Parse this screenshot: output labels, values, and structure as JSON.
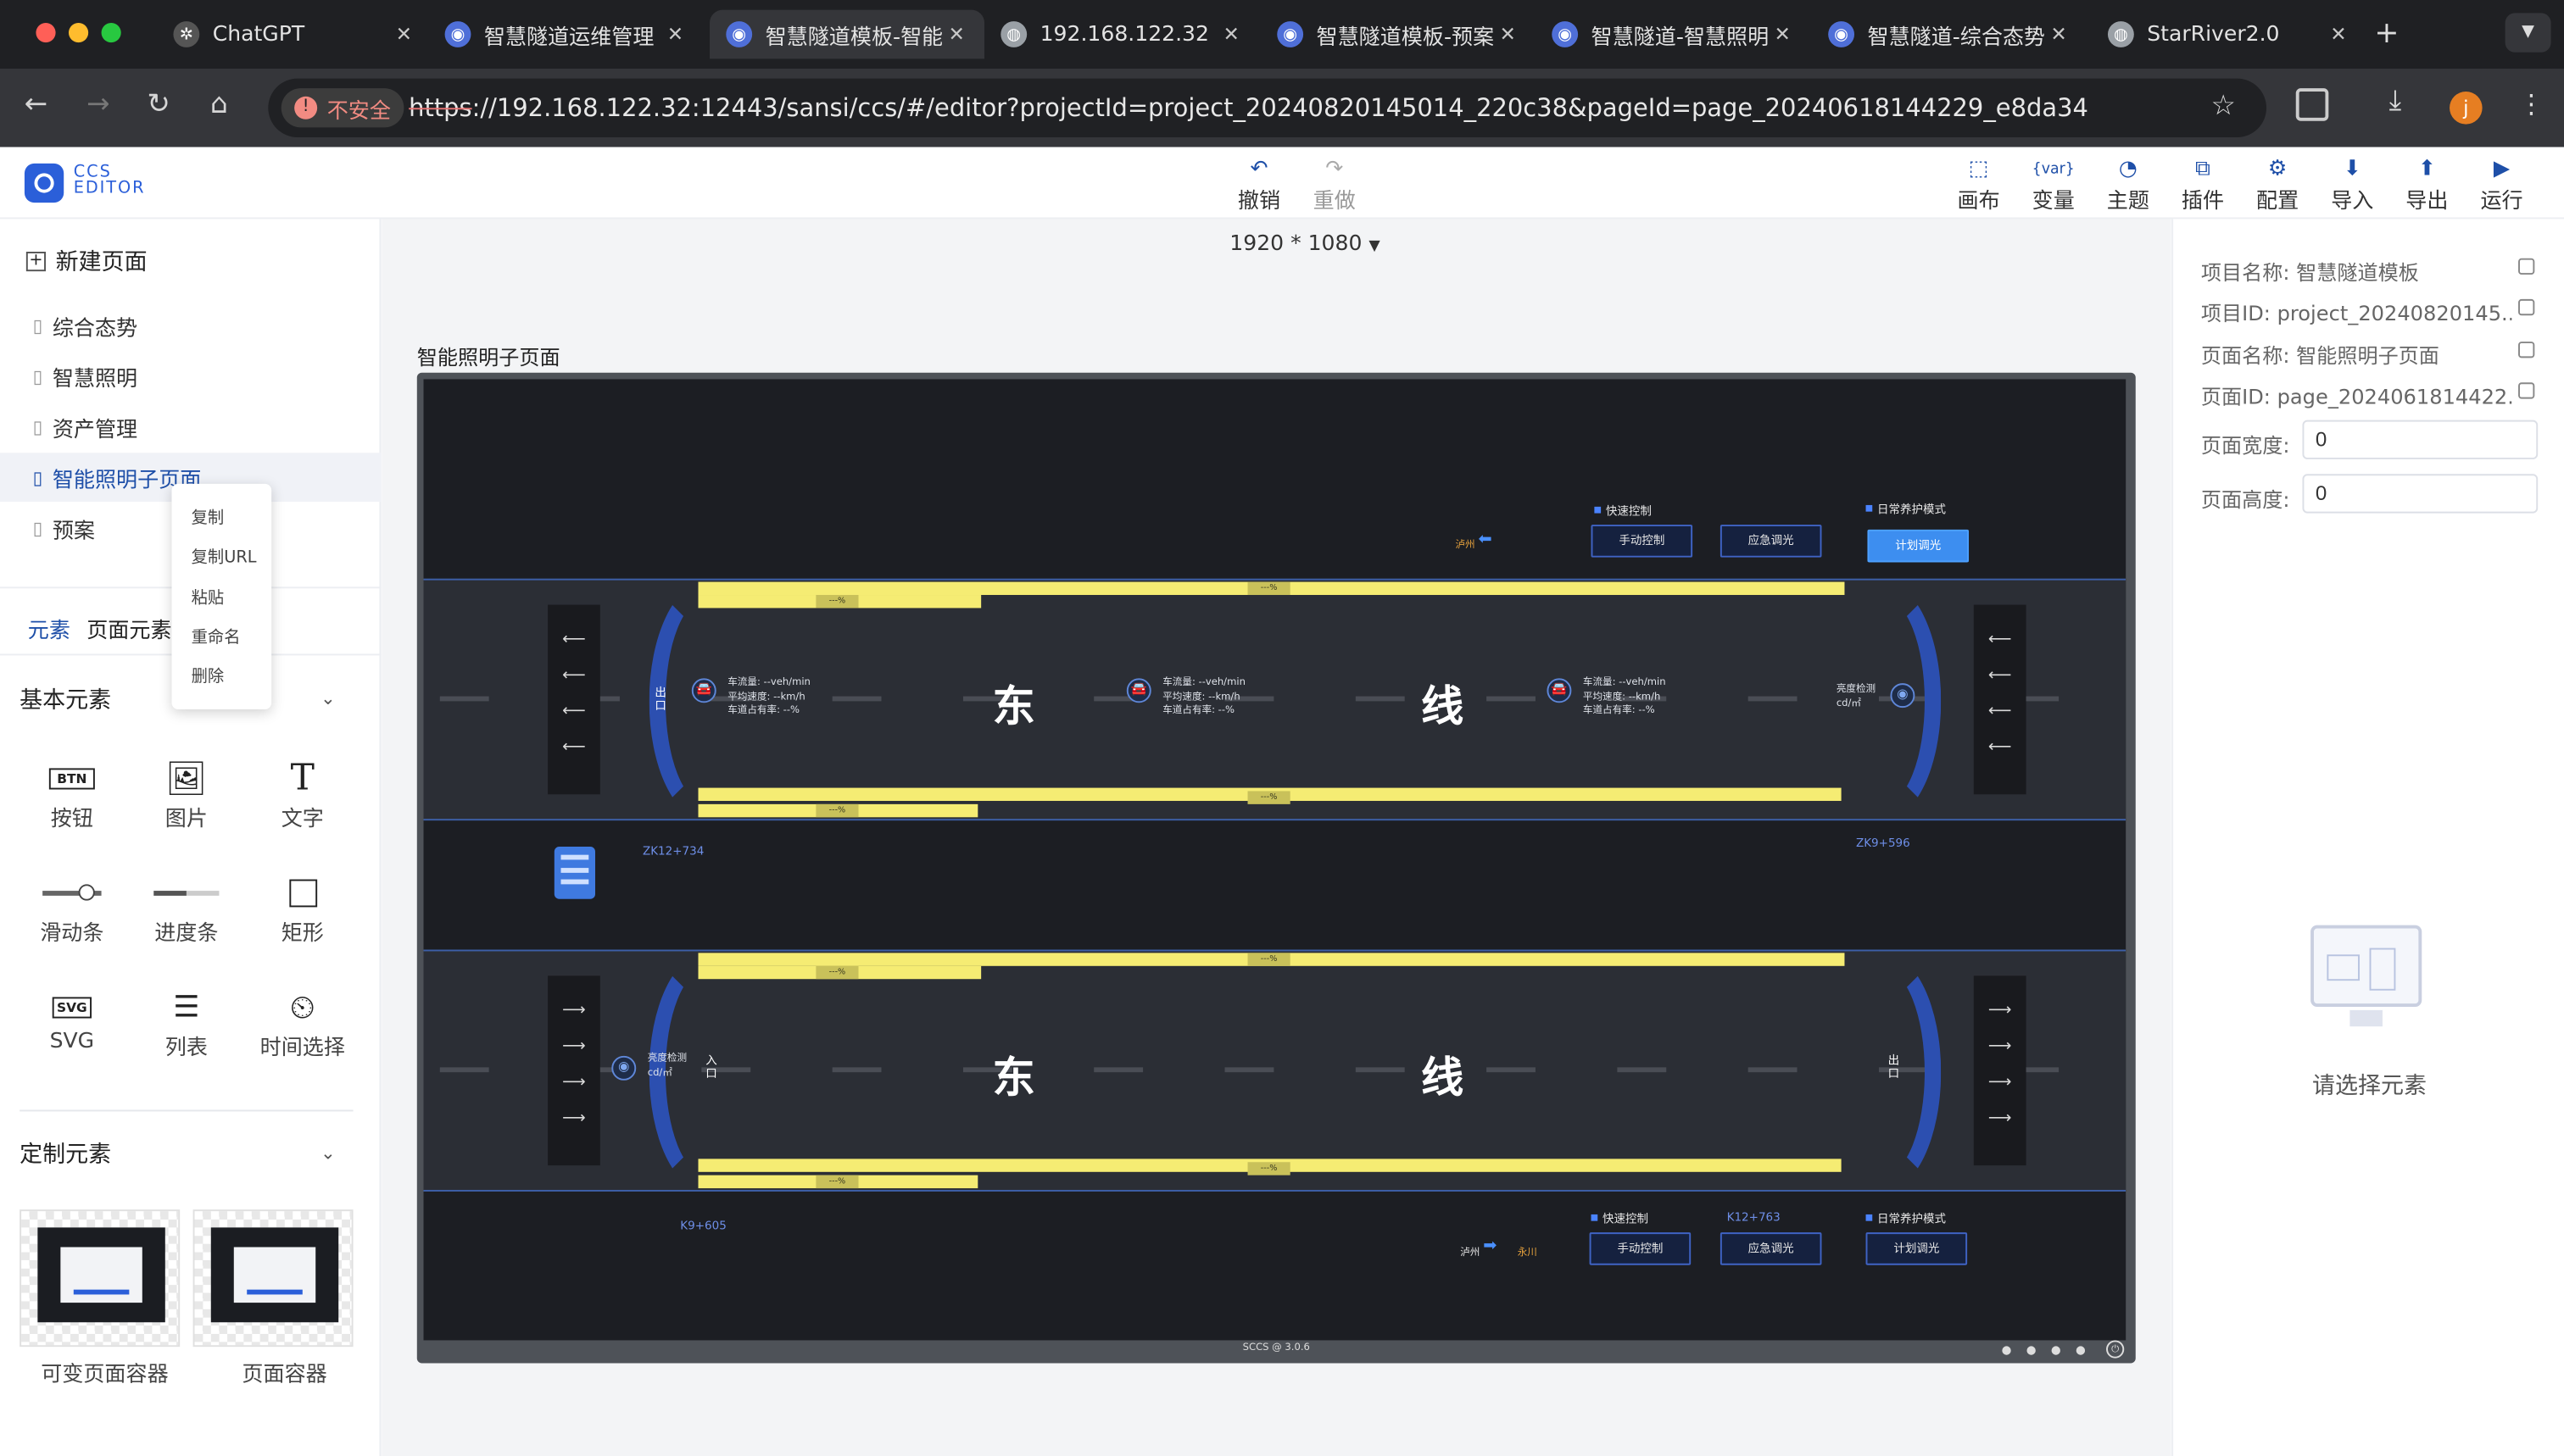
{
  "browser": {
    "tabs": [
      {
        "title": "ChatGPT",
        "icon": "chatgpt-icon",
        "active": false
      },
      {
        "title": "智慧隧道运维管理",
        "icon": "app-icon",
        "active": false
      },
      {
        "title": "智慧隧道模板-智能",
        "icon": "app-icon",
        "active": true
      },
      {
        "title": "192.168.122.32",
        "icon": "globe-icon",
        "active": false
      },
      {
        "title": "智慧隧道模板-预案",
        "icon": "app-icon",
        "active": false
      },
      {
        "title": "智慧隧道-智慧照明",
        "icon": "app-icon",
        "active": false
      },
      {
        "title": "智慧隧道-综合态势",
        "icon": "app-icon",
        "active": false
      },
      {
        "title": "StarRiver2.0",
        "icon": "globe-icon",
        "active": false
      }
    ],
    "security_label": "不安全",
    "url_scheme": "https",
    "url_rest": "://192.168.122.32:12443/sansi/ccs/#/editor?projectId=project_20240820145014_220c38&pageId=page_20240618144229_e8da34",
    "profile_initial": "j"
  },
  "logo": {
    "line1": "CCS",
    "line2": "EDITOR"
  },
  "toolbar": {
    "undo": "撤销",
    "redo": "重做",
    "right": [
      "画布",
      "变量",
      "主题",
      "插件",
      "配置",
      "导入",
      "导出",
      "运行"
    ]
  },
  "left": {
    "new_page": "新建页面",
    "pages": [
      "综合态势",
      "智慧照明",
      "资产管理",
      "智能照明子页面",
      "预案"
    ],
    "context_menu": [
      "复制",
      "复制URL",
      "粘贴",
      "重命名",
      "删除"
    ],
    "tabs": [
      "元素",
      "页面元素"
    ],
    "basic_title": "基本元素",
    "basic_elements": [
      "按钮",
      "图片",
      "文字",
      "滑动条",
      "进度条",
      "矩形",
      "SVG",
      "列表",
      "时间选择"
    ],
    "custom_title": "定制元素",
    "custom_elements": [
      "可变页面容器",
      "页面容器"
    ],
    "btn_icon_text": "BTN",
    "svg_icon_text": "SVG"
  },
  "center": {
    "resolution": "1920 * 1080",
    "page_title": "智能照明子页面"
  },
  "right": {
    "project_name_label": "项目名称:",
    "project_name": "智慧隧道模板",
    "project_id_label": "项目ID:",
    "project_id": "project_20240820145...",
    "page_name_label": "页面名称:",
    "page_name": "智能照明子页面",
    "page_id_label": "页面ID:",
    "page_id": "page_2024061814422...",
    "width_label": "页面宽度:",
    "width_value": "0",
    "height_label": "页面高度:",
    "height_value": "0",
    "empty_hint": "请选择元素"
  },
  "canvas": {
    "quick_control": "快速控制",
    "daily_mode": "日常养护模式",
    "manual": "手动控制",
    "emergency": "应急调光",
    "plan": "计划调光",
    "luzhou": "泸州",
    "yongchuan": "永川",
    "big1": "东",
    "big2": "线",
    "info_lines": [
      "车流量: --veh/min",
      "平均速度: --km/h",
      "车道占有率: --%"
    ],
    "pct": "---%",
    "exit_label": "出口",
    "entry_label": "入口",
    "brightness_label": "亮度检测",
    "brightness_unit": "cd/㎡",
    "stake1": "ZK12+734",
    "stake2": "ZK9+596",
    "stake3": "K9+605",
    "stake4": "K12+763",
    "footer": "SCCS @ 3.0.6"
  }
}
